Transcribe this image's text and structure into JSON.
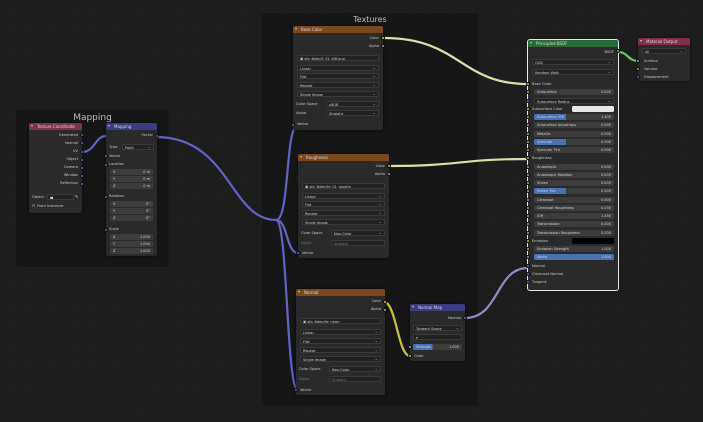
{
  "frames": {
    "mapping": "Mapping",
    "textures": "Textures"
  },
  "texcoord": {
    "title": "Texture Coordinate",
    "outputs": [
      "Generated",
      "Normal",
      "UV",
      "Object",
      "Camera",
      "Window",
      "Reflection"
    ],
    "object_label": "Object:",
    "from_instancer": "From Instancer"
  },
  "mapping": {
    "title": "Mapping",
    "out_vector": "Vector",
    "type_label": "Type:",
    "type_value": "Point",
    "in_vector": "Vector",
    "location_label": "Location",
    "location": [
      {
        "axis": "X",
        "value": "0 m"
      },
      {
        "axis": "Y",
        "value": "0 m"
      },
      {
        "axis": "Z",
        "value": "0 m"
      }
    ],
    "rotation_label": "Rotation",
    "rotation": [
      {
        "axis": "X",
        "value": "0°"
      },
      {
        "axis": "Y",
        "value": "0°"
      },
      {
        "axis": "Z",
        "value": "0°"
      }
    ],
    "scale_label": "Scale",
    "scale": [
      {
        "axis": "X",
        "value": "1.000"
      },
      {
        "axis": "Y",
        "value": "1.000"
      },
      {
        "axis": "Z",
        "value": "1.000"
      }
    ]
  },
  "base_color_tex": {
    "title": "Base Color",
    "out_color": "Color",
    "out_alpha": "Alpha",
    "image_name": "sfp_6dmc9_01_diff.png",
    "interpolation": "Linear",
    "projection": "Flat",
    "extension": "Repeat",
    "source": "Single Image",
    "colorspace_label": "Color Space",
    "colorspace_value": "sRGB",
    "alpha_label": "Alpha",
    "alpha_value": "Straight",
    "in_vector": "Vector"
  },
  "roughness_tex": {
    "title": "Roughness",
    "out_color": "Color",
    "out_alpha": "Alpha",
    "image_name": "sfp_6dmc9e_01_roughn",
    "interpolation": "Linear",
    "projection": "Flat",
    "extension": "Repeat",
    "source": "Single Image",
    "colorspace_label": "Color Space",
    "colorspace_value": "Non-Color",
    "alpha_label": "Alpha",
    "alpha_value": "Straight",
    "in_vector": "Vector"
  },
  "normal_tex": {
    "title": "Normal",
    "out_color": "Color",
    "out_alpha": "Alpha",
    "image_name": "sfp_6dmc9e_norm",
    "interpolation": "Linear",
    "projection": "Flat",
    "extension": "Repeat",
    "source": "Single Image",
    "colorspace_label": "Color Space",
    "colorspace_value": "Non-Color",
    "alpha_label": "Alpha",
    "alpha_value": "Straight",
    "in_vector": "Vector"
  },
  "normal_map": {
    "title": "Normal Map",
    "out_normal": "Normal",
    "space_value": "Tangent Space",
    "strength_label": "Strength",
    "strength_value": "1.000",
    "in_color": "Color"
  },
  "bsdf": {
    "title": "Principled BSDF",
    "out_bsdf": "BSDF",
    "distribution": "GGX",
    "subsurface_method": "Random Walk",
    "inputs": [
      {
        "kind": "label",
        "label": "Base Color"
      },
      {
        "kind": "num",
        "label": "Subsurface",
        "value": "0.000"
      },
      {
        "kind": "dd",
        "label": "Subsurface Radius"
      },
      {
        "kind": "color",
        "label": "Subsurface Color"
      },
      {
        "kind": "num",
        "label": "Subsurface IOR",
        "value": "1.400",
        "style": "half"
      },
      {
        "kind": "num",
        "label": "Subsurface Anisotropy",
        "value": "0.000"
      },
      {
        "kind": "num",
        "label": "Metallic",
        "value": "0.000"
      },
      {
        "kind": "num",
        "label": "Specular",
        "value": "0.500",
        "style": "half"
      },
      {
        "kind": "num",
        "label": "Specular Tint",
        "value": "0.000"
      },
      {
        "kind": "label",
        "label": "Roughness"
      },
      {
        "kind": "num",
        "label": "Anisotropic",
        "value": "0.000"
      },
      {
        "kind": "num",
        "label": "Anisotropic Rotation",
        "value": "0.000"
      },
      {
        "kind": "num",
        "label": "Sheen",
        "value": "0.000"
      },
      {
        "kind": "num",
        "label": "Sheen Tint",
        "value": "0.500",
        "style": "half"
      },
      {
        "kind": "num",
        "label": "Clearcoat",
        "value": "0.000"
      },
      {
        "kind": "num",
        "label": "Clearcoat Roughness",
        "value": "0.030"
      },
      {
        "kind": "num",
        "label": "IOR",
        "value": "1.450"
      },
      {
        "kind": "num",
        "label": "Transmission",
        "value": "0.000"
      },
      {
        "kind": "num",
        "label": "Transmission Roughness",
        "value": "0.000"
      },
      {
        "kind": "black",
        "label": "Emission"
      },
      {
        "kind": "num",
        "label": "Emission Strength",
        "value": "1.000"
      },
      {
        "kind": "num",
        "label": "Alpha",
        "value": "1.000",
        "style": "blue"
      },
      {
        "kind": "label",
        "label": "Normal"
      },
      {
        "kind": "label",
        "label": "Clearcoat Normal"
      },
      {
        "kind": "label",
        "label": "Tangent"
      }
    ]
  },
  "output": {
    "title": "Material Output",
    "target": "All",
    "inputs": [
      "Surface",
      "Volume",
      "Displacement"
    ]
  },
  "colors": {
    "image_header": "#7a4a1e",
    "vector_header": "#3c3c83",
    "input_header": "#83314a",
    "shader_header": "#2a6a35",
    "output_header": "#83314a",
    "wire_vector": "#6363c7",
    "wire_color": "#c7c729",
    "wire_float": "#a1a1a1",
    "wire_bsdf": "#63c763"
  }
}
